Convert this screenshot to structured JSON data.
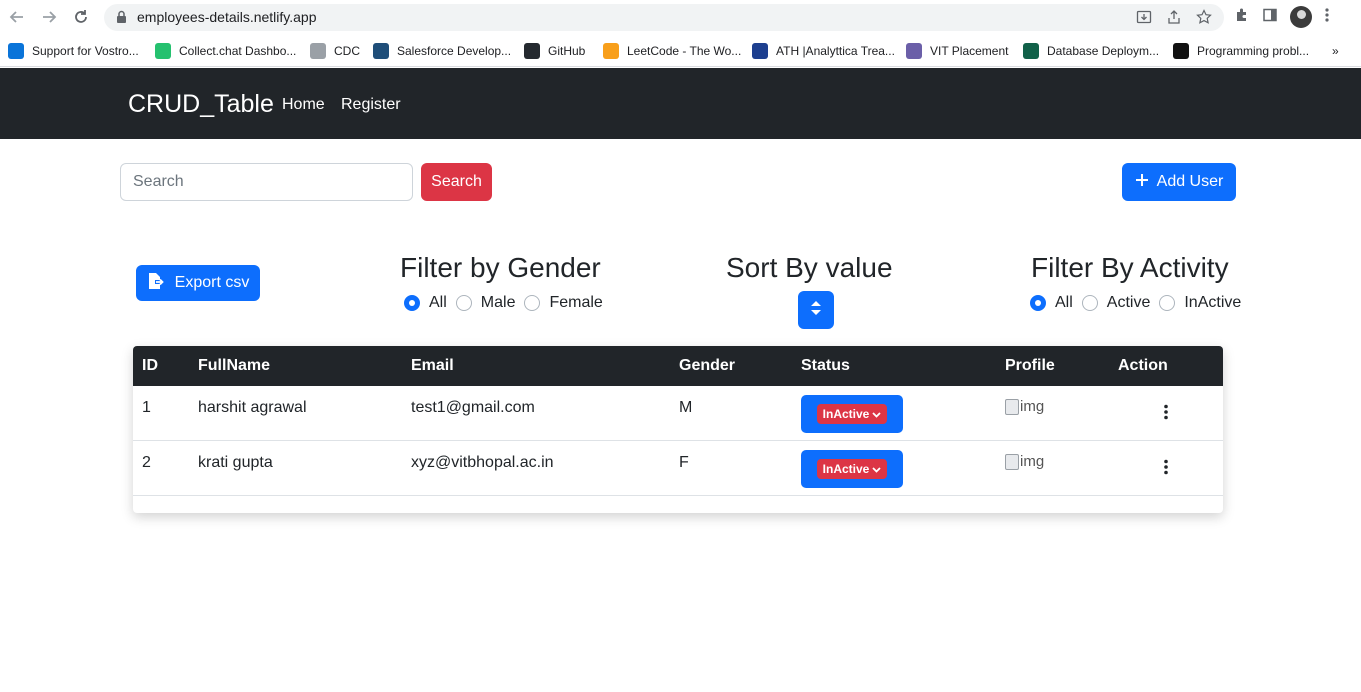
{
  "browser": {
    "url": "employees-details.netlify.app",
    "bookmarks": [
      {
        "label": "Support for Vostro...",
        "color": "#0a74d9"
      },
      {
        "label": "Collect.chat Dashbo...",
        "color": "#25c16f"
      },
      {
        "label": "CDC",
        "color": "#9aa0a6"
      },
      {
        "label": "Salesforce Develop...",
        "color": "#1f4e79"
      },
      {
        "label": "GitHub",
        "color": "#24292f"
      },
      {
        "label": "LeetCode - The Wo...",
        "color": "#f89f1b"
      },
      {
        "label": "ATH |Analyttica Trea...",
        "color": "#1d3f8f"
      },
      {
        "label": "VIT Placement",
        "color": "#6b5fa8"
      },
      {
        "label": "Database Deploym...",
        "color": "#116149"
      },
      {
        "label": "Programming probl...",
        "color": "#111111"
      }
    ],
    "more_label": "»"
  },
  "navbar": {
    "brand": "CRUD_Table",
    "links": [
      "Home",
      "Register"
    ]
  },
  "toolbar": {
    "search_placeholder": "Search",
    "search_button": "Search",
    "add_user_button": "Add User"
  },
  "export": {
    "label": "Export csv"
  },
  "filters": {
    "gender": {
      "title": "Filter by Gender",
      "options": [
        "All",
        "Male",
        "Female"
      ],
      "selected": "All"
    },
    "sort": {
      "title": "Sort By value"
    },
    "activity": {
      "title": "Filter By Activity",
      "options": [
        "All",
        "Active",
        "InActive"
      ],
      "selected": "All"
    }
  },
  "table": {
    "headers": [
      "ID",
      "FullName",
      "Email",
      "Gender",
      "Status",
      "Profile",
      "Action"
    ],
    "rows": [
      {
        "id": "1",
        "fullname": "harshit agrawal",
        "email": "test1@gmail.com",
        "gender": "M",
        "status": "InActive",
        "profile_alt": "img"
      },
      {
        "id": "2",
        "fullname": "krati gupta",
        "email": "xyz@vitbhopal.ac.in",
        "gender": "F",
        "status": "InActive",
        "profile_alt": "img"
      }
    ]
  },
  "colors": {
    "primary": "#0d6efd",
    "danger": "#dc3545",
    "dark": "#212529"
  }
}
